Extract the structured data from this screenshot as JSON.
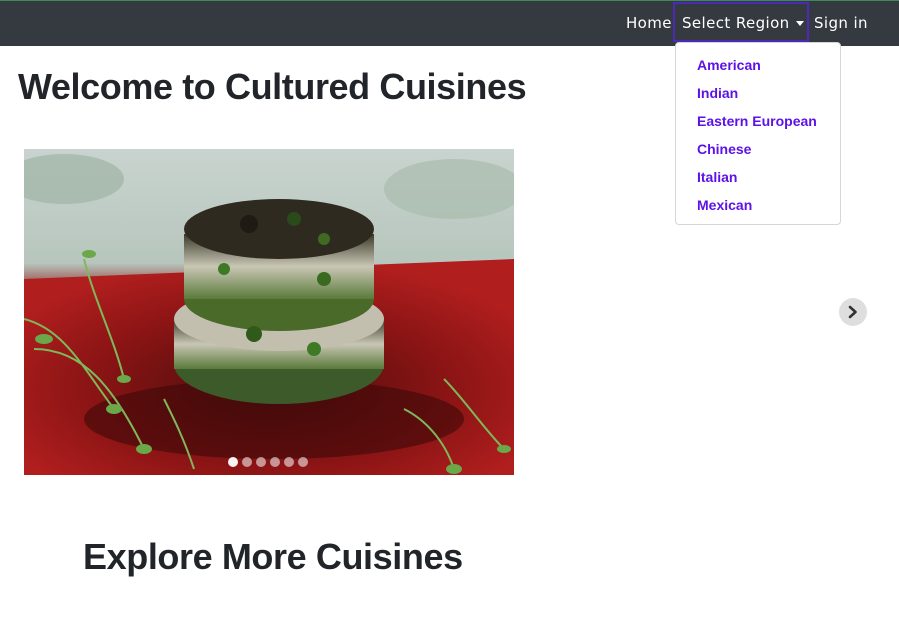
{
  "nav": {
    "home": "Home",
    "select_region": "Select Region",
    "sign_in": "Sign in"
  },
  "dropdown": {
    "items": [
      "American",
      "Indian",
      "Eastern European",
      "Chinese",
      "Italian",
      "Mexican"
    ]
  },
  "main": {
    "title": "Welcome to Cultured Cuisines",
    "section_title": "Explore More Cuisines"
  },
  "carousel": {
    "slide_count": 6,
    "active_index": 0
  },
  "colors": {
    "navbar": "#343a40",
    "dropdown_link": "#5d12e8",
    "focus_outline": "#4b2bb5"
  },
  "icons": {
    "next": "chevron-right-icon",
    "caret": "caret-down-icon"
  }
}
